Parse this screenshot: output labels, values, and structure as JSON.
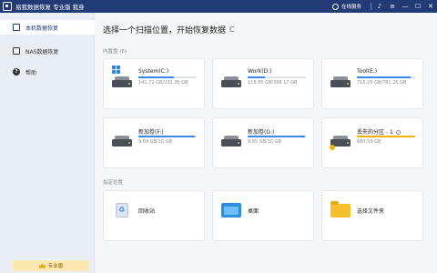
{
  "window": {
    "title": "易我数据恢复 专业版 我身",
    "service_label": "在线服务",
    "controls": [
      "♪",
      "≡",
      "—",
      "☐",
      "✕"
    ]
  },
  "sidebar": {
    "items": [
      {
        "label": "本机数据恢复",
        "icon": "computer-icon",
        "active": true
      },
      {
        "label": "NAS数据恢复",
        "icon": "nas-icon",
        "active": false
      },
      {
        "label": "帮助",
        "icon": "help-icon",
        "active": false
      }
    ],
    "pro_button": "专业版"
  },
  "main": {
    "heading": "选择一个扫描位置，开始恢复数据",
    "refresh_icon": "refresh-icon",
    "drives_section": "内置盘 (6)",
    "drives": [
      {
        "name": "System(C:)",
        "size": "141.72 GB/232.35 GB",
        "used_fraction": 0.61,
        "bar_color": "#3d86ea",
        "type": "system"
      },
      {
        "name": "Work(D:)",
        "size": "115.85 GB/398.17 GB",
        "used_fraction": 0.29,
        "bar_color": "#3d86ea",
        "type": "disk"
      },
      {
        "name": "Tool(E:)",
        "size": "715.25 GB/781.25 GB",
        "used_fraction": 0.92,
        "bar_color": "#3d86ea",
        "type": "disk"
      },
      {
        "name": "新加卷(F:)",
        "size": "9.69 GB/10 GB",
        "used_fraction": 0.97,
        "bar_color": "#3d86ea",
        "type": "disk"
      },
      {
        "name": "新加卷(G:)",
        "size": "9.85 GB/10 GB",
        "used_fraction": 0.98,
        "bar_color": "#3d86ea",
        "type": "disk"
      },
      {
        "name": "丢失的分区 - 1",
        "size": "683.59 GB",
        "used_fraction": 1.0,
        "bar_color": "#f3b400",
        "type": "lost"
      }
    ],
    "locations_section": "指定位置",
    "locations": [
      {
        "label": "回收站",
        "icon": "recycle-bin-icon"
      },
      {
        "label": "桌面",
        "icon": "desktop-icon"
      },
      {
        "label": "选择文件夹",
        "icon": "folder-icon"
      }
    ]
  }
}
